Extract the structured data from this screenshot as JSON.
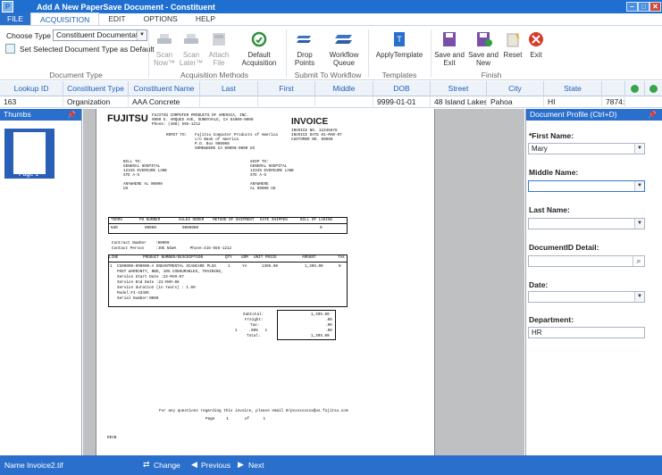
{
  "window": {
    "title": "Add A New PaperSave Document - Constituent",
    "app_letter": "P"
  },
  "menu": {
    "file": "FILE",
    "items": [
      "ACQUISITION",
      "EDIT",
      "OPTIONS",
      "HELP"
    ]
  },
  "ribbon": {
    "choose_type_label": "Choose Type",
    "choose_type_value": "Constituent Documentati",
    "set_default_label": "Set Selected Document Type as Default",
    "groups": {
      "document_type": "Document Type",
      "acquisition_methods": "Acquisition Methods",
      "submit_to_workflow": "Submit To Workflow",
      "templates": "Templates",
      "finish": "Finish"
    },
    "buttons": {
      "scan_now": "Scan Now™",
      "scan_later": "Scan Later™",
      "attach_file": "Attach File",
      "default_acquisition": "Default Acquisition",
      "drop_points": "Drop Points",
      "workflow_queue": "Workflow Queue",
      "apply_template": "ApplyTemplate",
      "save_exit": "Save and Exit",
      "save_new": "Save and New",
      "reset": "Reset",
      "exit": "Exit"
    }
  },
  "grid": {
    "columns": [
      "Lookup ID",
      "Constituent Type",
      "Constituent Name",
      "Last",
      "First",
      "Middle",
      "DOB",
      "Street",
      "City",
      "State",
      ""
    ],
    "row": [
      "163",
      "Organization",
      "AAA Concrete",
      "",
      "",
      "",
      "9999-01-01",
      "48 Island Lakes Sh",
      "Pahoa",
      "HI",
      "7874:"
    ]
  },
  "thumbs": {
    "title": "Thumbs",
    "page_label": "Page 1"
  },
  "profile": {
    "title": "Document Profile (Ctrl+D)",
    "fields": {
      "first_name_label": "*First Name:",
      "first_name_value": "Mary",
      "middle_name_label": "Middle Name:",
      "middle_name_value": "",
      "last_name_label": "Last Name:",
      "last_name_value": "",
      "document_id_label": "DocumentID Detail:",
      "document_id_value": "",
      "date_label": "Date:",
      "date_value": "",
      "department_label": "Department:",
      "department_value": "HR"
    }
  },
  "status": {
    "name_label": "Name",
    "file_name": "Invoice2.tif",
    "change": "Change",
    "previous": "Previous",
    "next": "Next"
  },
  "invoice": {
    "logo": "FUJITSU",
    "company": "FUJITSU COMPUTER PRODUCTS OF AMERICA, INC.",
    "address": "0000 E. ARQUES AVE, SUNNYVALE, CA 94000-0000",
    "phone": "Phone: (408) 555-1212",
    "remit_label": "REMIT TO:",
    "remit_lines": [
      "Fujitsu Computer Products of America",
      "c/o Bank of America",
      "P.O. Box 000000",
      "SOMEWHERE CA 00000-0000 US"
    ],
    "heading": "INVOICE",
    "meta": [
      "INVOICE NO. 12345678",
      "INVOICE DATE 01-MAR-07",
      "CUSTOMER NO. 00000"
    ],
    "bill_to_label": "BILL TO:",
    "bill_to": [
      "GENERAL HOSPITAL",
      "12345 EVERCURE LANE",
      "STE A-5",
      "",
      "ANYWHERE AL 00000",
      "US"
    ],
    "ship_to_label": "SHIP TO:",
    "ship_to": [
      "GENERAL HOSPITAL",
      "12345 EVERCURE LANE",
      "STE A-5",
      "",
      "ANYWHERE",
      "AL 00000 US"
    ],
    "terms_headers": [
      "TERMS",
      "PO NUMBER",
      "SALES ORDER",
      "METHOD OF SHIPMENT",
      "DATE SHIPPED",
      "BILL OF LADING"
    ],
    "terms_values": [
      "N30",
      "00000",
      "0000000",
      "",
      "",
      "0"
    ],
    "contract_lines": [
      "Contract Number    :00000",
      "Contact Person     :JOE NIWA      Phone:415-555-1212"
    ],
    "line_headers": [
      "LINE",
      "PRODUCT NUMBER/DESCRIPTION",
      "QTY",
      "UOM",
      "UNIT PRICE",
      "AMOUNT",
      "TAX"
    ],
    "line_values": [
      "1",
      "CG00000-000000-A ENDANTMENTAL SCANCARE PLUS",
      "1",
      "YA",
      "1395.00",
      "1,395.00",
      "N"
    ],
    "line_desc": [
      "POST WARRANTY, NBD, 10% CONSUMABLES, TRAINING,",
      "Service Start Date :23-MAR-07",
      "Service End Date :22-MAR-08",
      "Service duration (in Years) : 1.00",
      "Model:FI-4340C",
      "Serial Number:0000"
    ],
    "totals_labels": [
      "Subtotal:",
      "Freight:",
      "Tax:",
      "1     .00%   1",
      "Total:"
    ],
    "totals_values": [
      "1,395.00",
      ".00",
      ".00",
      ".00",
      "1,395.00"
    ],
    "footer": "For any questions regarding this invoice, please email 0/pxxxxxxxxx@us.fujitsu.com",
    "page_line": "Page     1       of      1",
    "corner": "REVB"
  },
  "colors": {
    "accent": "#2a6fcc",
    "title_bar": "#1e6fcf",
    "link": "#1e5fb8"
  }
}
